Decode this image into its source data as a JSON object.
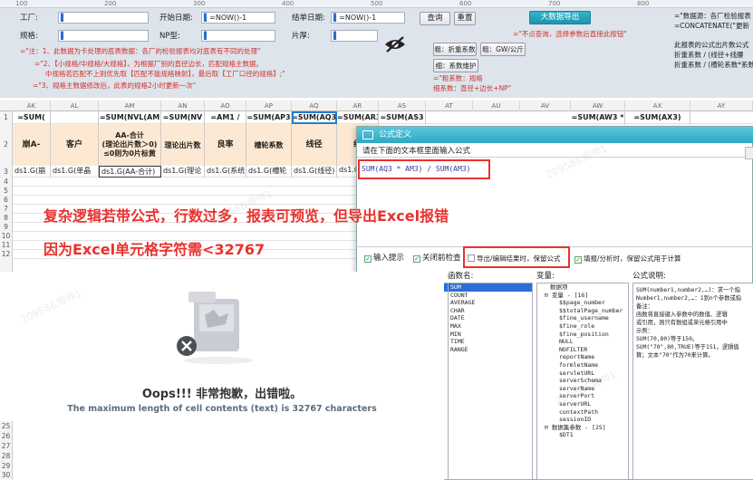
{
  "designer": {
    "ruler": [
      "100",
      "200",
      "300",
      "400",
      "500",
      "600",
      "700",
      "800"
    ],
    "factory_label": "工厂:",
    "start_date_label": "开始日期:",
    "start_date_value": "=NOW()-1",
    "end_date_label": "结单日期:",
    "end_date_value": "=NOW()-1",
    "query_button": "查询",
    "reset_button": "重置",
    "bigdata_button": "大数据导出",
    "spec_label": "规格:",
    "np_label": "NP型:",
    "sheet_label": "片厚:",
    "hint_query": "=\"不点查询，选择参数后直接此按钮\"",
    "note1": "=\"注：1、此数据为卡处理的底表数据：各厂的检验报表均对底表有不同的处理\"",
    "note2": "=\"2、【小规格/中规格/大规格】，为根据厂别的直径边长，匹配规格主数据。",
    "note2b": "中规格若匹配不上则优先取【匹配不能规格映射】，最后取【工厂口径的规格】;\"",
    "note3": "=\"3、规格主数据修改后，此表的规格2小时更新一次\"",
    "src_title": "=\"数据源：各厂检验报表",
    "concat": "=CONCATENATE(\"更新",
    "formula_note1": "此报表的公式出片数公式",
    "formula_note2": "折重系数 / (线径+线腰",
    "formula_note3": "折重系数 / (槽轮系数*系数",
    "coef_label": "粗：折重系数",
    "coef2_label": "粗：GW/公斤",
    "sys_label": "细：系数维护",
    "spec_hint": "=\"粗系数：规格",
    "spec_hint2": "细系数：直径+边长+NP\""
  },
  "sheet": {
    "columns": [
      "AK",
      "AL",
      "AM",
      "AN",
      "AO",
      "AP",
      "AQ",
      "AR",
      "AS",
      "AT",
      "AU",
      "AV",
      "AW",
      "AX",
      "AY"
    ],
    "formula_row": [
      "=SUM(",
      "",
      "=SUM(NVL(AM",
      "=SUM(NV",
      "=AM1 /",
      "=SUM(AP3",
      "=SUM(AQ3",
      "=SUM(AR3",
      "=SUM(AS3",
      "",
      "",
      "",
      "=SUM(AW3 *",
      "=SUM(AX3)",
      ""
    ],
    "header_row": [
      "崩A-",
      "客户",
      "AA-合计\n(理论出片数＞0)\n≤0则为0片标黄",
      "理论出片数",
      "良率",
      "槽轮系数",
      "线径",
      "线",
      "",
      "",
      "",
      "",
      "",
      "",
      ""
    ],
    "data_row": [
      "ds1.G(崩",
      "ds1.G(单晶",
      "ds1.G(AA-合计)",
      "ds1.G(理论",
      "ds1.G(系统",
      "ds1.G(槽轮",
      "ds1.G(线径)",
      "ds1.G",
      "",
      "",
      "",
      "",
      "",
      "",
      ""
    ],
    "row_numbers": [
      "1",
      "2",
      "3",
      "4",
      "5",
      "6",
      "7",
      "8",
      "9",
      "10",
      "11",
      "12",
      "25",
      "26",
      "27",
      "28",
      "29",
      "30"
    ]
  },
  "dialog": {
    "title": "公式定义",
    "instruction": "请在下面的文本框里面输入公式",
    "formula": "SUM(AQ3 * AM3) / SUM(AM3)",
    "cb_hint": "输入提示",
    "cb_check": "关闭前检查",
    "cb_export": "导出/编辑结果时，保留公式",
    "cb_fill": "填报/分析时，保留公式用于计算",
    "functions_label": "函数名:",
    "variables_label": "变量:",
    "desc_label": "公式说明:",
    "functions": [
      "SUM",
      "COUNT",
      "AVERAGE",
      "CHAR",
      "DATE",
      "MAX",
      "MIN",
      "TIME",
      "RANGE"
    ],
    "variables": [
      "数据项",
      "变量 - [16]",
      "$$page_number",
      "$$totalPage_number",
      "$fine_username",
      "$fine_role",
      "$fine_position",
      "NULL",
      "NOFILTER",
      "reportName",
      "formletName",
      "servletURL",
      "serverSchema",
      "serverName",
      "serverPort",
      "serverURL",
      "contextPath",
      "sessionID",
      "数据集参数 - [25]",
      "$DT1"
    ],
    "description": [
      "SUM(number1,number2,…)：求一个指",
      "Number1,number2,…：1到n个参数或指",
      "备注：",
      "函数将直接键入参数中的数值、逻辑",
      "或引用，则只有数组或单元格引用中",
      "示例：",
      "SUM(70,80)等于150。",
      "SUM(\"70\",80,TRUE)等于151，逻辑值",
      "算；文本\"70\"作为70来计算。"
    ]
  },
  "error": {
    "title": "Oops!!! 非常抱歉，出错啦。",
    "message": "The maximum length of cell contents (text) is 32767 characters"
  },
  "annotations": {
    "line1": "复杂逻辑若带公式，行数过多，报表可预览，但导出Excel报错",
    "line2": "因为Excel单元格字符需<32767"
  },
  "watermark": "20958&周帅1"
}
